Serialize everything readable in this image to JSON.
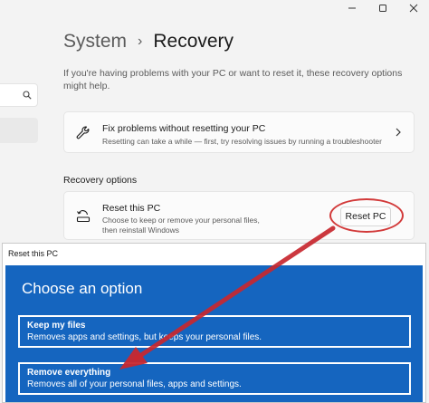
{
  "window": {
    "controls": [
      "minimize",
      "maximize",
      "close"
    ]
  },
  "nav": {
    "search_icon": "search-icon"
  },
  "header": {
    "parent": "System",
    "separator": "›",
    "current": "Recovery"
  },
  "intro_text": "If you're having problems with your PC or want to reset it, these recovery options might help.",
  "fix_card": {
    "icon": "wrench-icon",
    "title": "Fix problems without resetting your PC",
    "description": "Resetting can take a while — first, try resolving issues by running a troubleshooter"
  },
  "recovery_options": {
    "label": "Recovery options",
    "reset_card": {
      "icon": "reset-pc-icon",
      "title": "Reset this PC",
      "description": "Choose to keep or remove your personal files, then reinstall Windows",
      "button_label": "Reset PC"
    }
  },
  "dialog": {
    "title": "Reset this PC",
    "heading": "Choose an option",
    "options": [
      {
        "title": "Keep my files",
        "description": "Removes apps and settings, but keeps your personal files."
      },
      {
        "title": "Remove everything",
        "description": "Removes all of your personal files, apps and settings."
      }
    ]
  },
  "annotation": {
    "color": "#d23a3a"
  },
  "colors": {
    "dialog_blue": "#1565bf",
    "background": "#f3f3f3"
  }
}
